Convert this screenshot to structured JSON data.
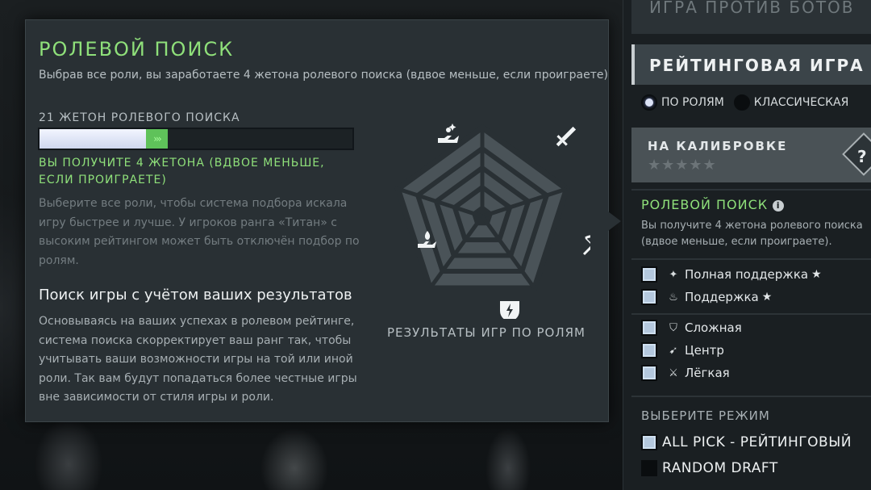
{
  "tooltip": {
    "title": "РОЛЕВОЙ ПОИСК",
    "subtitle": "Выбрав все роли, вы заработаете 4 жетона ролевого поиска (вдвое меньше, если проиграете)",
    "token_label": "21 ЖЕТОН РОЛЕВОГО ПОИСКА",
    "token_progress_fraction": 0.34,
    "token_gain_fraction": 0.07,
    "gain_arrows": "›››",
    "gain_note": "ВЫ ПОЛУЧИТЕ 4 ЖЕТОНА (ВДВОЕ МЕНЬШЕ, ЕСЛИ ПРОИГРАЕТЕ)",
    "description": "Выберите все роли, чтобы система подбора искала игру быстрее и лучше. У игроков ранга «Титан» с высоким рейтингом может быть отключён подбор по ролям.",
    "section_title": "Поиск игры с учётом ваших результатов",
    "section_text": "Основываясь на ваших успехах в ролевом рейтинге, система поиска скорректирует ваш ранг так, чтобы учитывать ваши возможности игры на той или иной роли. Так вам будут попадаться более честные игры вне зависимости от стиля игры и роли.",
    "radar_caption": "РЕЗУЛЬТАТЫ ИГР ПО РОЛЯМ",
    "radar_icons": [
      "full-support-icon",
      "easy-lane-sword-icon",
      "mid-lane-bow-icon",
      "offlane-shield-icon",
      "support-flame-icon"
    ]
  },
  "sidebar": {
    "bots_label": "ИГРА ПРОТИВ БОТОВ",
    "rated_label": "РЕЙТИНГОВАЯ ИГРА",
    "radio_roles": "ПО РОЛЯМ",
    "radio_classic": "КЛАССИЧЕСКАЯ",
    "radio_selected": "ПО РОЛЯМ",
    "calibration_label": "НА КАЛИБРОВКЕ",
    "calibration_stars": "★★★★★",
    "rank_badge": "?",
    "role_search_title": "РОЛЕВОЙ ПОИСК",
    "info_glyph": "i",
    "role_search_desc": "Вы получите 4 жетона ролевого поиска (вдвое меньше, если проиграете).",
    "roles": [
      {
        "label": "Полная поддержка",
        "icon": "full-support-icon",
        "checked": true,
        "starred": true
      },
      {
        "label": "Поддержка",
        "icon": "support-icon",
        "checked": true,
        "starred": true
      },
      {
        "label": "Сложная",
        "icon": "shield-icon",
        "checked": true,
        "starred": false
      },
      {
        "label": "Центр",
        "icon": "bow-icon",
        "checked": true,
        "starred": false
      },
      {
        "label": "Лёгкая",
        "icon": "sword-icon",
        "checked": true,
        "starred": false
      }
    ],
    "mode_title": "ВЫБЕРИТЕ РЕЖИМ",
    "modes": [
      {
        "label": "ALL PICK - РЕЙТИНГОВЫЙ",
        "checked": true
      },
      {
        "label": "RANDOM DRAFT",
        "checked": false
      }
    ]
  },
  "colors": {
    "accent_green": "#8fe07a",
    "panel_bg": "#293034"
  }
}
